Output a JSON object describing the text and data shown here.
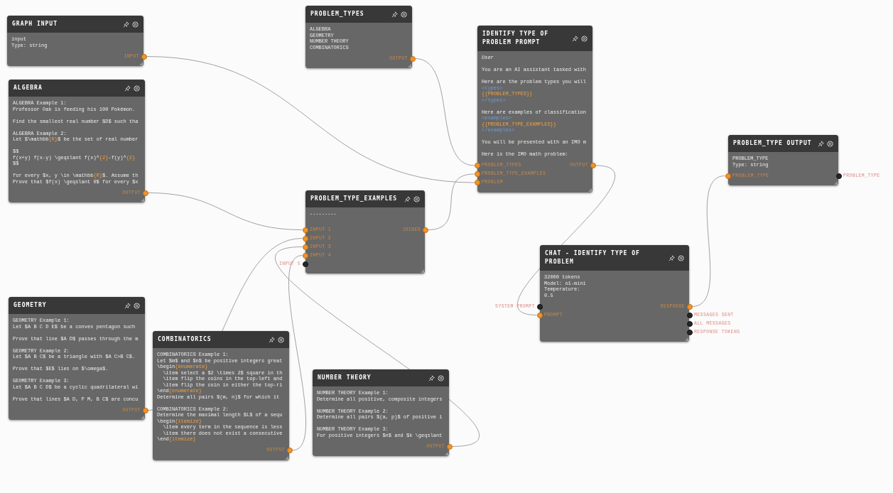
{
  "nodes": [
    {
      "title": "GRAPH INPUT",
      "body": [
        [
          "input",
          "Type: string"
        ]
      ],
      "outputs": [
        {
          "label": "INPUT",
          "connected": true
        }
      ]
    },
    {
      "title": "PROBLEM_TYPES",
      "body": [
        [
          "ALGEBRA",
          "GEOMETRY",
          "NUMBER THEORY",
          "COMBINATORICS"
        ]
      ],
      "outputs": [
        {
          "label": "OUTPUT",
          "connected": true
        }
      ]
    },
    {
      "title": "IDENTIFY TYPE OF PROBLEM PROMPT",
      "role": "User",
      "body": [
        [
          "You are an AI assistant tasked with"
        ],
        [
          "Here are the problem types you will",
          [
            {
              "text": "<types>",
              "kind": "tag"
            }
          ],
          [
            {
              "text": "{{PROBLEM_TYPES}}",
              "kind": "var"
            }
          ],
          [
            {
              "text": "</types>",
              "kind": "tag"
            }
          ]
        ],
        [
          "Here are examples of classification",
          [
            {
              "text": "<examples>",
              "kind": "tag"
            }
          ],
          [
            {
              "text": "{{PROBLEM_TYPE_EXAMPLES}}",
              "kind": "var"
            }
          ],
          [
            {
              "text": "</examples>",
              "kind": "tag"
            }
          ]
        ],
        [
          "You will be presented with an IMO m"
        ],
        [
          "Here is the IMO math problem:"
        ]
      ],
      "inputs": [
        {
          "label": "PROBLEM_TYPES",
          "connected": true
        },
        {
          "label": "PROBLEM_TYPE_EXAMPLES",
          "connected": true
        },
        {
          "label": "PROBLEM",
          "connected": true
        }
      ],
      "outputs": [
        {
          "label": "OUTPUT",
          "connected": true
        }
      ]
    },
    {
      "title": "ALGEBRA",
      "body": [
        [
          "ALGEBRA Example 1:",
          "Professor Oak is feeding his 100 Pokémon."
        ],
        [
          "Find the smallest real number $D$ such tha"
        ],
        [
          "ALGEBRA Example 2:",
          [
            {
              "text": "Let $\\mathbb",
              "kind": "plain"
            },
            {
              "text": "{R}",
              "kind": "var"
            },
            {
              "text": "$ be the set of real number",
              "kind": "plain"
            }
          ]
        ],
        [
          "$$",
          [
            {
              "text": "f(x+y) f(x-y) \\geqslant f(x)^",
              "kind": "plain"
            },
            {
              "text": "{2}",
              "kind": "var"
            },
            {
              "text": "-f(y)^",
              "kind": "plain"
            },
            {
              "text": "{2}",
              "kind": "var"
            }
          ],
          "$$"
        ],
        [
          [
            {
              "text": "for every $x, y \\in \\mathbb",
              "kind": "plain"
            },
            {
              "text": "{R}",
              "kind": "var"
            },
            {
              "text": "$. Assume th",
              "kind": "plain"
            }
          ],
          "Prove that $f(x) \\geqslant 0$ for every $x"
        ]
      ],
      "outputs": [
        {
          "label": "OUTPUT",
          "connected": true
        }
      ]
    },
    {
      "title": "PROBLEM_TYPE_EXAMPLES",
      "body": [
        [
          "---------"
        ]
      ],
      "inputs": [
        {
          "label": "INPUT 1",
          "connected": true
        },
        {
          "label": "INPUT 2",
          "connected": true
        },
        {
          "label": "INPUT 3",
          "connected": true
        },
        {
          "label": "INPUT 4",
          "connected": true
        },
        {
          "label": "INPUT 5",
          "connected": false
        }
      ],
      "outputs": [
        {
          "label": "JOINED",
          "connected": true
        }
      ]
    },
    {
      "title": "PROBLEM_TYPE OUTPUT",
      "body": [
        [
          "PROBLEM_TYPE",
          "Type: string"
        ]
      ],
      "inputs": [
        {
          "label": "PROBLEM_TYPE",
          "connected": true
        }
      ],
      "outputs": [
        {
          "label": "PROBLEM_TYPE",
          "connected": false
        }
      ]
    },
    {
      "title": "CHAT - IDENTIFY TYPE OF PROBLEM",
      "body": [
        [
          "32000 tokens",
          "Model: o1-mini",
          "Temperature:",
          "0.5"
        ]
      ],
      "inputs": [
        {
          "label": "SYSTEM PROMPT",
          "connected": false
        },
        {
          "label": "PROMPT",
          "connected": true
        }
      ],
      "outputs": [
        {
          "label": "RESPONSE",
          "connected": true
        },
        {
          "label": "MESSAGES SENT",
          "connected": false
        },
        {
          "label": "ALL MESSAGES",
          "connected": false
        },
        {
          "label": "RESPONSE TOKENS",
          "connected": false
        }
      ]
    },
    {
      "title": "GEOMETRY",
      "body": [
        [
          "GEOMETRY Example 1:",
          "Let $A B C D E$ be a convex pentagon such"
        ],
        [
          "Prove that line $A D$ passes through the m"
        ],
        [
          "GEOMETRY Example 2:",
          "Let $A B C$ be a triangle with $A C>B C$."
        ],
        [
          "Prove that $E$ lies on $\\omega$."
        ],
        [
          "GEOMETRY Example 3:",
          "Let $A B C D$ be a cyclic quadrilateral wi"
        ],
        [
          "Prove that lines $A D, P M, B C$ are concu"
        ]
      ],
      "outputs": [
        {
          "label": "OUTPUT",
          "connected": true
        }
      ]
    },
    {
      "title": "COMBINATORICS",
      "body": [
        [
          "COMBINATORICS Example 1:",
          "Let $m$ and $n$ be positive integers great",
          [
            {
              "text": "\\begin",
              "kind": "plain"
            },
            {
              "text": "{enumerate}",
              "kind": "var"
            }
          ],
          "  \\item select a $2 \\times 2$ square in th",
          "  \\item flip the coins in the top-left and",
          "  \\item flip the coin in either the top-ri",
          [
            {
              "text": "\\end",
              "kind": "plain"
            },
            {
              "text": "{enumerate}",
              "kind": "var"
            }
          ],
          "Determine all pairs $(m, n)$ for which it"
        ],
        [
          "COMBINATORICS Example 2:",
          "Determine the maximal length $L$ of a sequ",
          [
            {
              "text": "\\begin",
              "kind": "plain"
            },
            {
              "text": "{itemize}",
              "kind": "var"
            }
          ],
          "  \\item every term in the sequence is less",
          "  \\item there does not exist a consecutive",
          [
            {
              "text": "\\end",
              "kind": "plain"
            },
            {
              "text": "{itemize}",
              "kind": "var"
            }
          ]
        ]
      ],
      "outputs": [
        {
          "label": "OUTPUT",
          "connected": true
        }
      ]
    },
    {
      "title": "NUMBER THEORY",
      "body": [
        [
          "NUMBER THEORY Example 1:",
          "Determine all positive, composite integers"
        ],
        [
          "NUMBER THEORY Example 2:",
          "Determine all pairs $(a, p)$ of positive i"
        ],
        [
          "NUMBER THEORY Example 3:",
          "For positive integers $n$ and $k \\geqslant"
        ]
      ],
      "outputs": [
        {
          "label": "OUTPUT",
          "connected": true
        }
      ]
    }
  ]
}
